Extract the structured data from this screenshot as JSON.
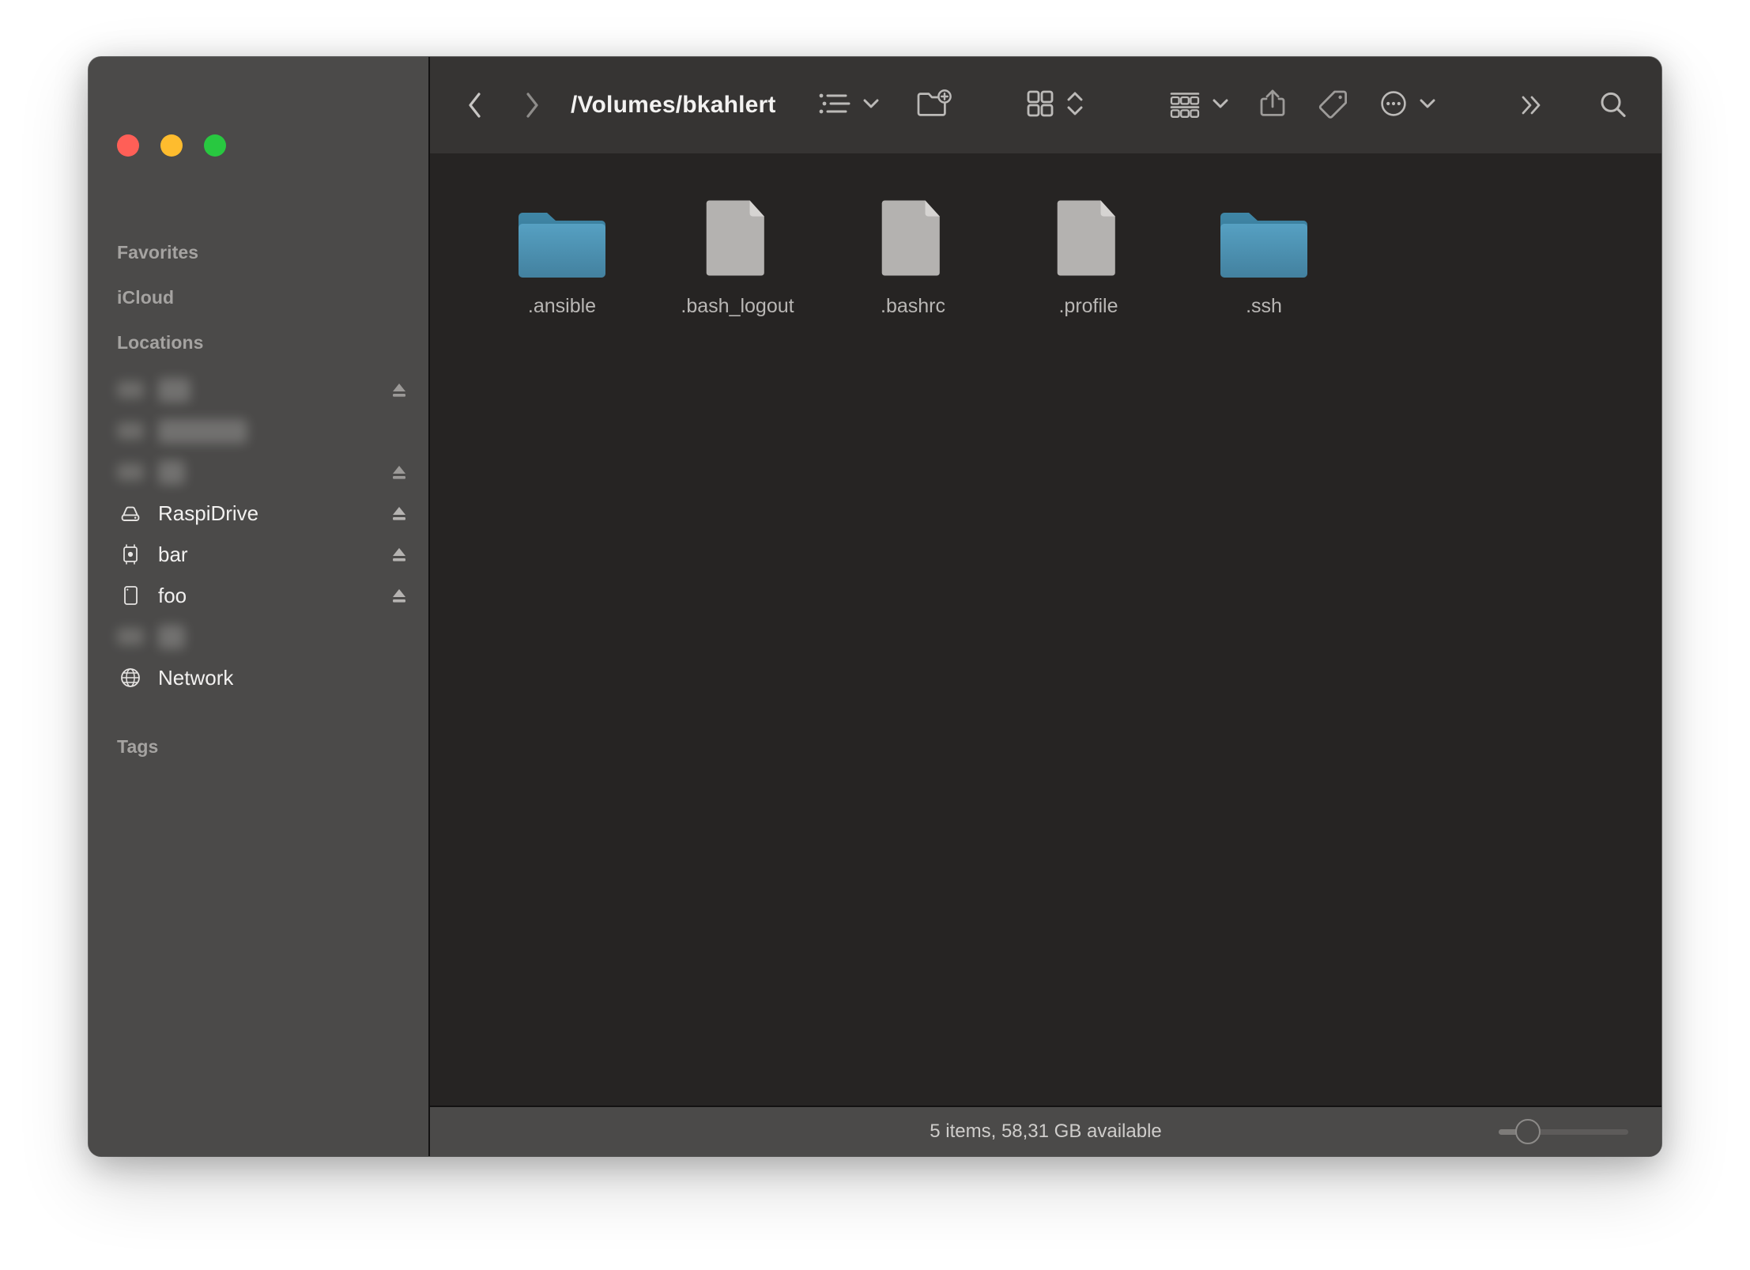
{
  "window": {
    "traffic_lights": [
      {
        "name": "close",
        "color": "#ff5f57"
      },
      {
        "name": "minimize",
        "color": "#febc2e"
      },
      {
        "name": "maximize",
        "color": "#28c840"
      }
    ]
  },
  "toolbar": {
    "back_label": "Back",
    "forward_label": "Forward",
    "path_title": "/Volumes/bkahlert",
    "buttons": [
      {
        "name": "view-options-button",
        "icon": "list-view-icon",
        "has_chevron": true
      },
      {
        "name": "new-folder-button",
        "icon": "new-folder-icon",
        "has_chevron": false
      },
      {
        "name": "icon-view-button",
        "icon": "grid-view-icon",
        "has_chevron": false
      },
      {
        "name": "sort-stepper",
        "icon": "chevron-updown-icon",
        "has_chevron": false
      },
      {
        "name": "group-by-button",
        "icon": "group-by-icon",
        "has_chevron": true
      },
      {
        "name": "share-button",
        "icon": "share-icon",
        "has_chevron": false
      },
      {
        "name": "tag-button",
        "icon": "tag-icon",
        "has_chevron": false
      },
      {
        "name": "more-actions-button",
        "icon": "ellipsis-circle-icon",
        "has_chevron": true
      },
      {
        "name": "toolbar-overflow-button",
        "icon": "chevron-double-right-icon",
        "has_chevron": false
      },
      {
        "name": "search-button",
        "icon": "search-icon",
        "has_chevron": false
      }
    ]
  },
  "sidebar": {
    "sections": [
      {
        "title": "Favorites",
        "items": []
      },
      {
        "title": "iCloud",
        "items": []
      },
      {
        "title": "Locations",
        "items": [
          {
            "label": "",
            "icon": "drive-icon",
            "eject": true,
            "redacted": true
          },
          {
            "label": "",
            "icon": "drive-icon",
            "eject": false,
            "redacted": true
          },
          {
            "label": "",
            "icon": "drive-icon",
            "eject": true,
            "redacted": true
          },
          {
            "label": "RaspiDrive",
            "icon": "external-drive-icon",
            "eject": true,
            "redacted": false
          },
          {
            "label": "bar",
            "icon": "mac-mini-icon",
            "eject": true,
            "redacted": false
          },
          {
            "label": "foo",
            "icon": "ipad-icon",
            "eject": true,
            "redacted": false
          },
          {
            "label": "",
            "icon": "drive-icon",
            "eject": false,
            "redacted": true
          },
          {
            "label": "Network",
            "icon": "globe-icon",
            "eject": false,
            "redacted": false
          }
        ]
      },
      {
        "title": "Tags",
        "items": []
      }
    ]
  },
  "files": [
    {
      "name": ".ansible",
      "type": "folder"
    },
    {
      "name": ".bash_logout",
      "type": "file"
    },
    {
      "name": ".bashrc",
      "type": "file"
    },
    {
      "name": ".profile",
      "type": "file"
    },
    {
      "name": ".ssh",
      "type": "folder"
    }
  ],
  "statusbar": {
    "text": "5 items, 58,31 GB available",
    "zoom_value": 20
  },
  "colors": {
    "sidebar_bg": "#4b4a49",
    "toolbar_bg": "#363433",
    "content_bg": "#262423",
    "folder_blue": "#4a8cad",
    "file_gray": "#b3b1af"
  }
}
